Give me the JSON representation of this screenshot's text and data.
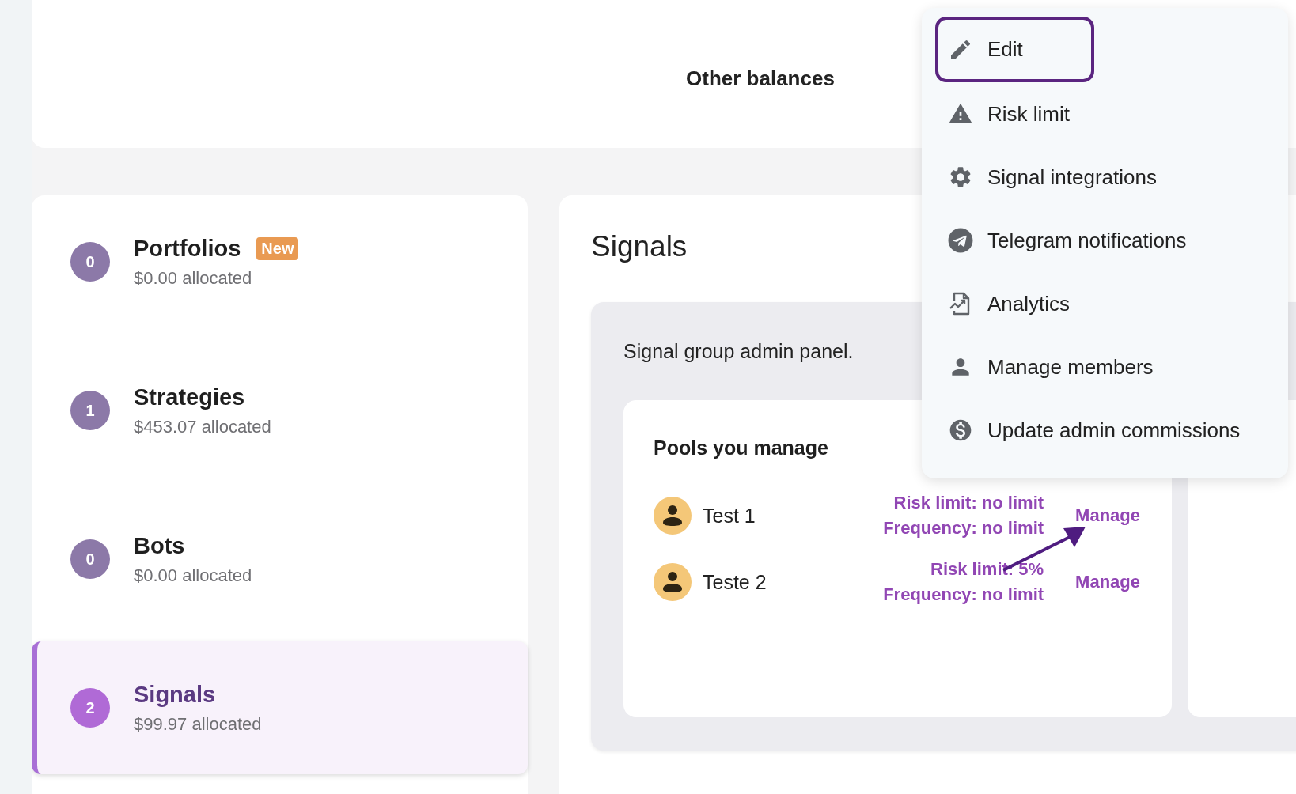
{
  "header": {
    "title": "Other balances"
  },
  "sidebar": {
    "items": [
      {
        "count": "0",
        "title": "Portfolios",
        "badge": "New",
        "subtitle": "$0.00 allocated",
        "selected": false
      },
      {
        "count": "1",
        "title": "Strategies",
        "subtitle": "$453.07 allocated",
        "selected": false
      },
      {
        "count": "0",
        "title": "Bots",
        "subtitle": "$0.00 allocated",
        "selected": false
      },
      {
        "count": "2",
        "title": "Signals",
        "subtitle": "$99.97 allocated",
        "selected": true
      }
    ]
  },
  "main": {
    "title": "Signals",
    "panel": {
      "description": "Signal group admin panel.",
      "pools_card": {
        "title": "Pools you manage",
        "pools": [
          {
            "name": "Test 1",
            "risk_limit": "Risk limit: no limit",
            "frequency": "Frequency: no limit",
            "action": "Manage"
          },
          {
            "name": "Teste 2",
            "risk_limit": "Risk limit: 5%",
            "frequency": "Frequency: no limit",
            "action": "Manage"
          }
        ]
      }
    }
  },
  "menu": {
    "items": [
      {
        "kind": "pencil",
        "label": "Edit",
        "focused": true
      },
      {
        "kind": "warning",
        "label": "Risk limit",
        "focused": false
      },
      {
        "kind": "gear",
        "label": "Signal integrations",
        "focused": false
      },
      {
        "kind": "telegram",
        "label": "Telegram notifications",
        "focused": false
      },
      {
        "kind": "analytics",
        "label": "Analytics",
        "focused": false
      },
      {
        "kind": "person",
        "label": "Manage members",
        "focused": false
      },
      {
        "kind": "dollar",
        "label": "Update admin commissions",
        "focused": false
      }
    ]
  }
}
